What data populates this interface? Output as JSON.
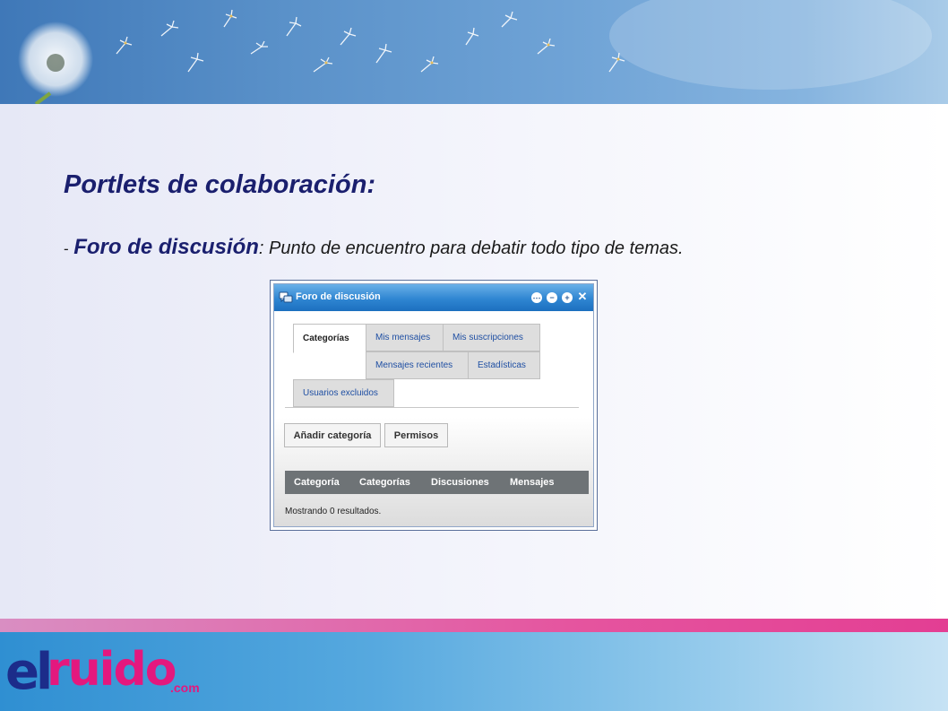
{
  "slide": {
    "title": "Portlets de colaboración:",
    "bullet_dash": "-",
    "bullet_term": "Foro de discusión",
    "bullet_desc": ": Punto de encuentro para debatir todo tipo de temas."
  },
  "portlet": {
    "title": "Foro de discusión",
    "icons": [
      "forum-icon",
      "options-icon",
      "minimize-icon",
      "maximize-icon",
      "close-icon"
    ],
    "tabs": [
      "Categorías",
      "Mis mensajes",
      "Mis suscripciones",
      "Mensajes recientes",
      "Estadísticas",
      "Usuarios excluidos"
    ],
    "buttons": {
      "add_category": "Añadir categoría",
      "permissions": "Permisos"
    },
    "table_headers": [
      "Categoría",
      "Categorías",
      "Discusiones",
      "Mensajes"
    ],
    "result_text": "Mostrando 0 resultados."
  },
  "logo": {
    "el": "el",
    "ruido": "ruido",
    "com": ".com"
  },
  "colors": {
    "title_navy": "#1a1f6e",
    "tab_link_blue": "#1f4fa3",
    "titlebar_blue": "#2f86d2",
    "table_header_gray": "#6e7376",
    "brand_pink": "#e4187e"
  }
}
